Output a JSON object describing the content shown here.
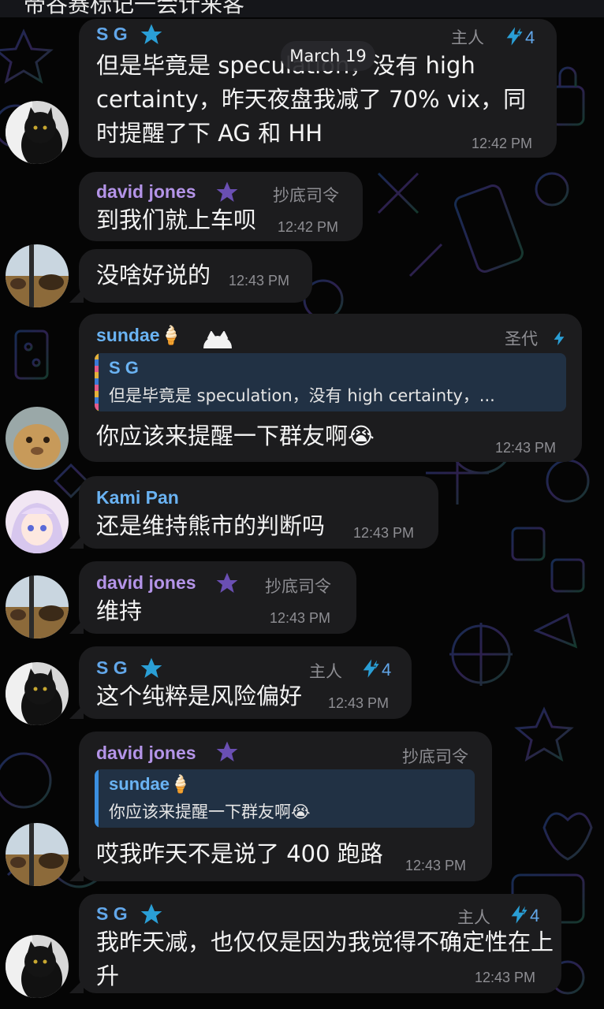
{
  "header": {
    "title": "帝谷赛标记一会计来客"
  },
  "date_separator": "March 19",
  "messages": [
    {
      "sender": "S G",
      "role": "主人",
      "boost": "4",
      "text": "但是毕竟是 speculation，没有 high certainty，昨天夜盘我减了 70% vix，同时提醒了下 AG 和 HH",
      "time": "12:42 PM"
    },
    {
      "sender": "david jones",
      "role": "抄底司令",
      "text": "到我们就上车呗",
      "time": "12:42 PM"
    },
    {
      "text": "没啥好说的",
      "time": "12:43 PM"
    },
    {
      "sender": "sundae",
      "sender_emoji": "🍦",
      "role": "圣代",
      "reply_to": {
        "name": "S G",
        "text": "但是毕竟是 speculation，没有 high certainty，..."
      },
      "text": "你应该来提醒一下群友啊😭",
      "time": "12:43 PM"
    },
    {
      "sender": "Kami Pan",
      "text": "还是维持熊市的判断吗",
      "time": "12:43 PM"
    },
    {
      "sender": "david jones",
      "role": "抄底司令",
      "text": "维持",
      "time": "12:43 PM"
    },
    {
      "sender": "S G",
      "role": "主人",
      "boost": "4",
      "text": "这个纯粹是风险偏好",
      "time": "12:43 PM"
    },
    {
      "sender": "david jones",
      "role": "抄底司令",
      "reply_to": {
        "name": "sundae",
        "name_emoji": "🍦",
        "text": "你应该来提醒一下群友啊😭"
      },
      "text": "哎我昨天不是说了 400 跑路",
      "time": "12:43 PM"
    },
    {
      "sender": "S G",
      "role": "主人",
      "boost": "4",
      "text": "我昨天减，也仅仅是因为我觉得不确定性在上升",
      "time": "12:43 PM"
    }
  ],
  "colors": {
    "sg_name": "#62a7ea",
    "dj_name": "#b494e8",
    "sundae_name": "#6ab3f3",
    "bubble": "#1c1c1e",
    "meta": "#8e8e93"
  }
}
